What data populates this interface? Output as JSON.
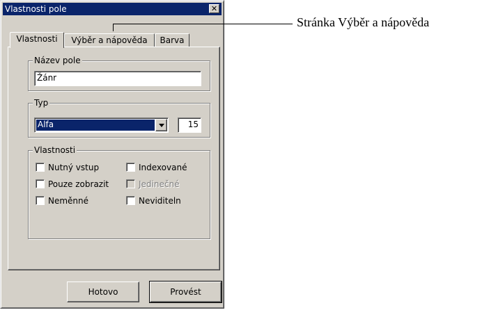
{
  "window": {
    "title": "Vlastnosti pole",
    "close_glyph": "✕"
  },
  "tabs": [
    {
      "label": "Vlastnosti",
      "active": true
    },
    {
      "label": "Výběr a nápověda",
      "active": false
    },
    {
      "label": "Barva",
      "active": false
    }
  ],
  "field_name_group": {
    "label": "Název pole",
    "value": "Žánr"
  },
  "type_group": {
    "label": "Typ",
    "selected": "Alfa",
    "size": "15"
  },
  "properties_group": {
    "label": "Vlastnosti",
    "checkboxes": [
      {
        "label": "Nutný vstup",
        "checked": false,
        "enabled": true
      },
      {
        "label": "Indexované",
        "checked": false,
        "enabled": true
      },
      {
        "label": "Pouze zobrazit",
        "checked": false,
        "enabled": true
      },
      {
        "label": "Jedinečné",
        "checked": false,
        "enabled": false
      },
      {
        "label": "Neměnné",
        "checked": false,
        "enabled": true
      },
      {
        "label": "Neviditeln",
        "checked": false,
        "enabled": true
      }
    ]
  },
  "buttons": {
    "done": "Hotovo",
    "apply": "Provést"
  },
  "callout": {
    "text": "Stránka Výběr a nápověda"
  },
  "colors": {
    "titlebar": "#0a246a",
    "face": "#d4d0c8",
    "selection": "#0a246a"
  }
}
